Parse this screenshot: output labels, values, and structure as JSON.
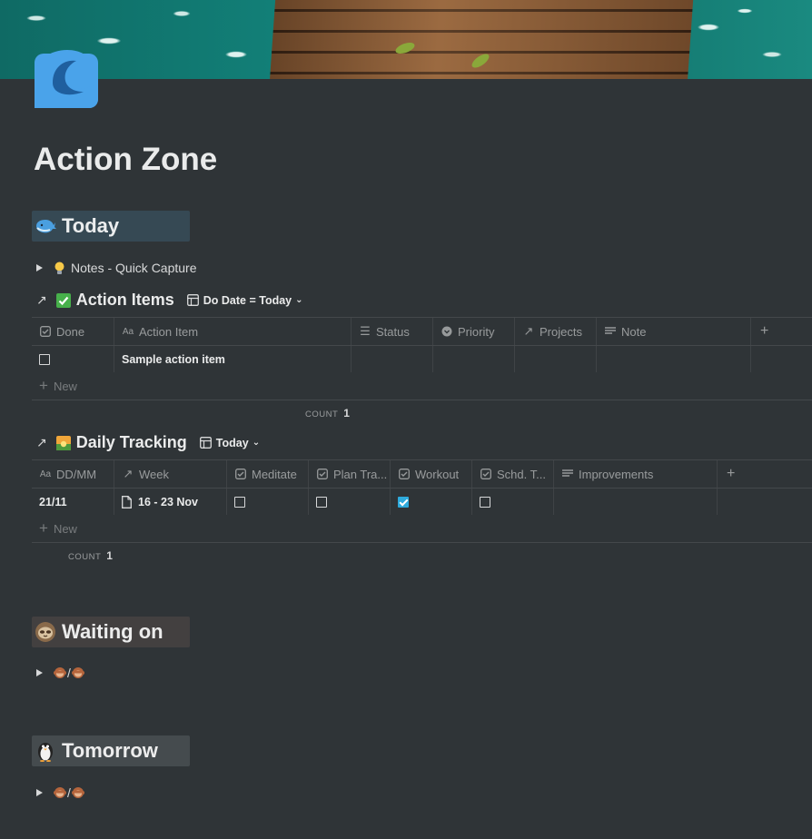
{
  "page": {
    "title": "Action Zone",
    "icon": "wave-icon"
  },
  "colors": {
    "background": "#2f3437",
    "accent_checked": "#2eaadc",
    "heading_bg_blue": "#364954",
    "heading_bg_brown": "#434040",
    "heading_bg_gray": "#454b4e"
  },
  "sections": {
    "today": {
      "label": "Today",
      "icon": "whale-icon"
    },
    "waiting": {
      "label": "Waiting on",
      "icon": "sloth-icon"
    },
    "tomorrow": {
      "label": "Tomorrow",
      "icon": "penguin-icon"
    }
  },
  "notes_toggle": {
    "icon": "lightbulb-icon",
    "label": "Notes - Quick Capture"
  },
  "action_items": {
    "title": "Action Items",
    "icon": "check-box-icon",
    "view": "Do Date = Today",
    "columns": [
      {
        "label": "Done",
        "icon": "checkbox-prop-icon"
      },
      {
        "label": "Action Item",
        "icon": "text-aa-icon"
      },
      {
        "label": "Status",
        "icon": "list-icon"
      },
      {
        "label": "Priority",
        "icon": "select-icon"
      },
      {
        "label": "Projects",
        "icon": "relation-arrow-icon"
      },
      {
        "label": "Note",
        "icon": "text-lines-icon"
      }
    ],
    "rows": [
      {
        "done": false,
        "item": "Sample action item",
        "status": "",
        "priority": "",
        "projects": "",
        "note": ""
      }
    ],
    "new_label": "New",
    "count_label": "COUNT",
    "count_value": "1"
  },
  "daily_tracking": {
    "title": "Daily Tracking",
    "icon": "sunrise-icon",
    "view": "Today",
    "columns": [
      {
        "label": "DD/MM",
        "icon": "text-aa-icon"
      },
      {
        "label": "Week",
        "icon": "relation-arrow-icon"
      },
      {
        "label": "Meditate",
        "icon": "checkbox-prop-icon"
      },
      {
        "label": "Plan Tra...",
        "icon": "checkbox-prop-icon"
      },
      {
        "label": "Workout",
        "icon": "checkbox-prop-icon"
      },
      {
        "label": "Schd. T...",
        "icon": "checkbox-prop-icon"
      },
      {
        "label": "Improvements",
        "icon": "text-lines-icon"
      }
    ],
    "rows": [
      {
        "date": "21/11",
        "week": "16 - 23 Nov",
        "meditate": false,
        "plan": false,
        "workout": true,
        "schd": false,
        "improvements": ""
      }
    ],
    "new_label": "New",
    "count_label": "COUNT",
    "count_value": "1"
  },
  "waiting_toggle": {
    "label": "/",
    "icons": [
      "monkey-icon",
      "monkey-icon"
    ]
  },
  "tomorrow_toggle": {
    "label": "/",
    "icons": [
      "monkey-icon",
      "monkey-icon"
    ]
  }
}
